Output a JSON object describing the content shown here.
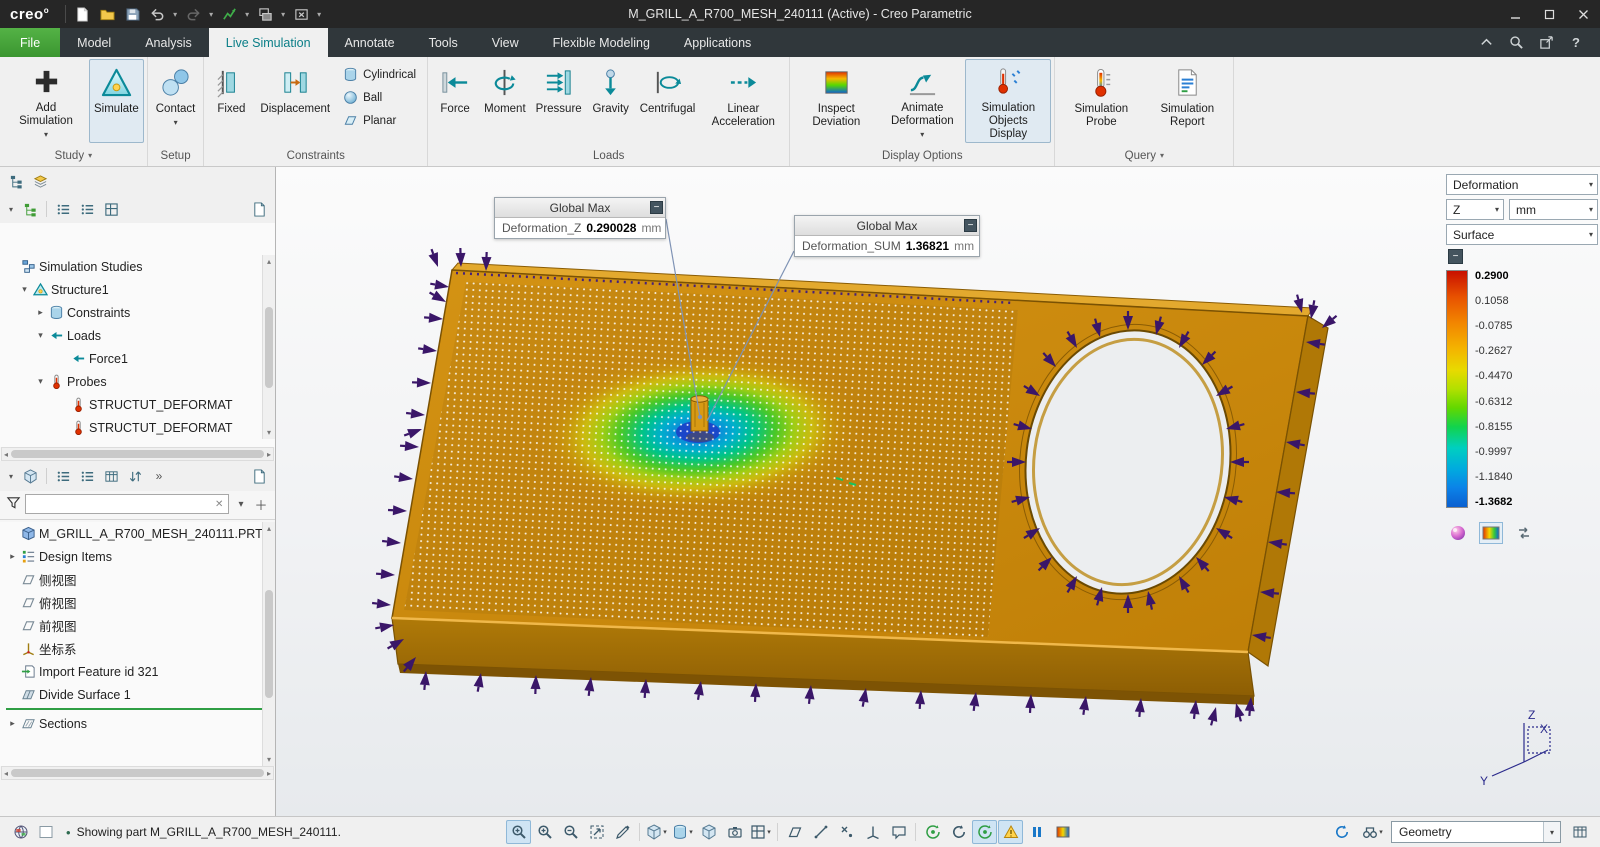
{
  "titlebar": {
    "logo": "creo",
    "title": "M_GRILL_A_R700_MESH_240111 (Active) - Creo Parametric"
  },
  "tabs": {
    "file": "File",
    "model": "Model",
    "analysis": "Analysis",
    "live_simulation": "Live Simulation",
    "annotate": "Annotate",
    "tools": "Tools",
    "view": "View",
    "flexible_modeling": "Flexible Modeling",
    "applications": "Applications"
  },
  "ribbon": {
    "study": {
      "label": "Study",
      "add_simulation": "Add Simulation",
      "simulate": "Simulate"
    },
    "setup": {
      "label": "Setup",
      "contact": "Contact"
    },
    "constraints": {
      "label": "Constraints",
      "fixed": "Fixed",
      "displacement": "Displacement",
      "cylindrical": "Cylindrical",
      "ball": "Ball",
      "planar": "Planar"
    },
    "loads": {
      "label": "Loads",
      "force": "Force",
      "moment": "Moment",
      "pressure": "Pressure",
      "gravity": "Gravity",
      "centrifugal": "Centrifugal",
      "linear_acceleration": "Linear Acceleration"
    },
    "display_options": {
      "label": "Display Options",
      "inspect_deviation": "Inspect Deviation",
      "animate_deformation": "Animate Deformation",
      "simulation_objects_display": "Simulation Objects Display"
    },
    "query": {
      "label": "Query",
      "simulation_probe": "Simulation Probe",
      "simulation_report": "Simulation Report"
    }
  },
  "left_panel": {
    "tree1": {
      "items": [
        "Simulation Studies",
        "Structure1",
        "Constraints",
        "Loads",
        "Force1",
        "Probes",
        "STRUCTUT_DEFORMAT",
        "STRUCTUT_DEFORMAT"
      ]
    },
    "tree2": {
      "items": [
        "M_GRILL_A_R700_MESH_240111.PRT",
        "Design Items",
        "侧视图",
        "俯视图",
        "前视图",
        "坐标系",
        "Import Feature id 321",
        "Divide Surface 1",
        "Sections"
      ]
    }
  },
  "viewport": {
    "annotations": [
      {
        "header": "Global Max",
        "label": "Deformation_Z",
        "value": "0.290028",
        "unit": "mm"
      },
      {
        "header": "Global Max",
        "label": "Deformation_SUM",
        "value": "1.36821",
        "unit": "mm"
      }
    ],
    "triad": {
      "x": "X",
      "y": "Y",
      "z": "Z"
    }
  },
  "legend": {
    "result_type": "Deformation",
    "component": "Z",
    "unit": "mm",
    "display": "Surface",
    "values": [
      "0.2900",
      "0.1058",
      "-0.0785",
      "-0.2627",
      "-0.4470",
      "-0.6312",
      "-0.8155",
      "-0.9997",
      "-1.1840",
      "-1.3682"
    ]
  },
  "statusbar": {
    "bullet": "•",
    "message": "Showing part M_GRILL_A_R700_MESH_240111.",
    "filter": "Geometry"
  }
}
